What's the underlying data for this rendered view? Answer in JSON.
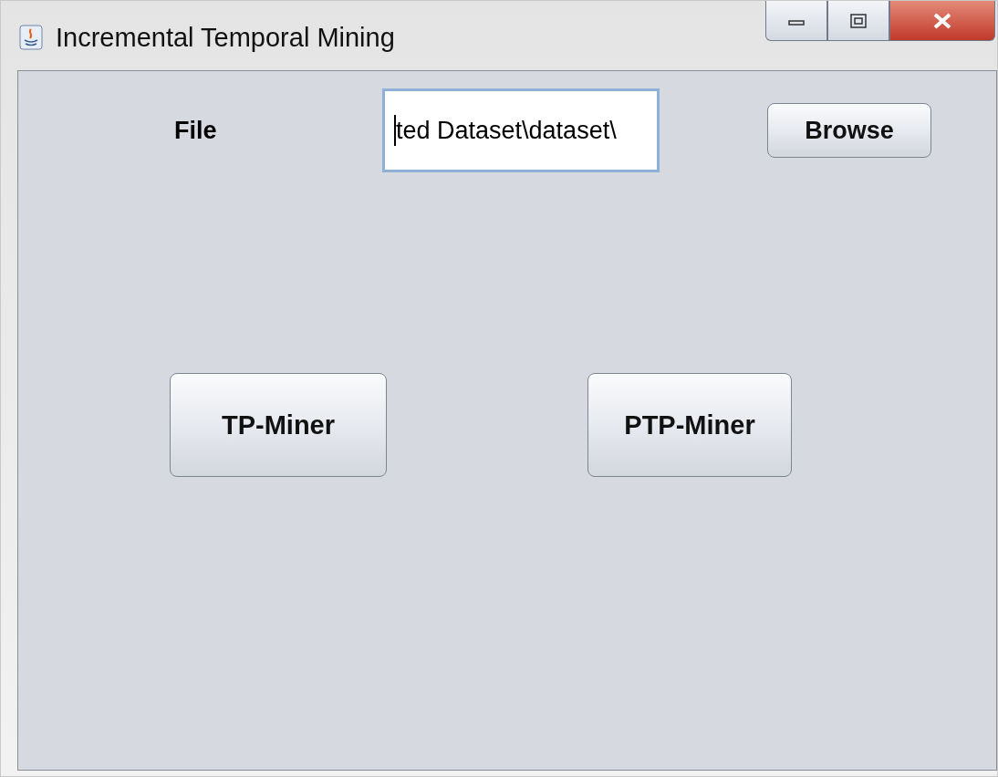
{
  "window": {
    "title": "Incremental Temporal Mining"
  },
  "file_row": {
    "label": "File",
    "field_value": "ted Dataset\\dataset\\",
    "browse_button": "Browse"
  },
  "buttons": [
    "TP-Miner",
    "PTP-Miner"
  ]
}
